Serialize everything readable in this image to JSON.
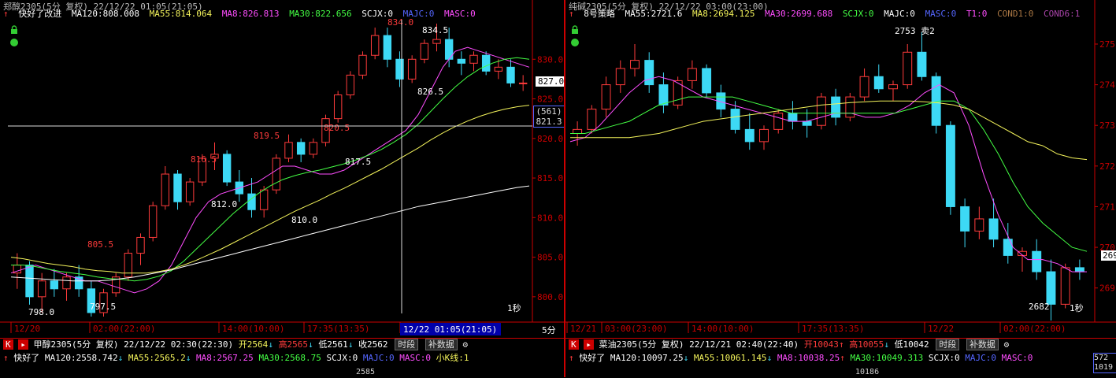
{
  "left": {
    "title": "郑醇2305(5分 复权) 22/12/22 01:05(21:05)",
    "indicator_name": "快好了改进",
    "ma120": "MA120:808.008",
    "ma55": "MA55:814.064",
    "ma8": "MA8:826.813",
    "ma30": "MA30:822.656",
    "scjx": "SCJX:0",
    "majc": "MAJC:0",
    "masc": "MASC:0",
    "price_tag": "827.0",
    "cursor_box_top": "(561)",
    "cursor_box_bottom": "821.3",
    "interval_label": "1秒",
    "period_label": "5分",
    "y_ticks": [
      "830.0",
      "825.0",
      "820.0",
      "815.0",
      "810.0",
      "805.0",
      "800.0"
    ],
    "x_labels": [
      "12/20",
      "02:00(22:00)",
      "14:00(10:00)",
      "17:35(13:35)",
      "12/22 01:05(21:05)"
    ],
    "annotations": [
      "834.0",
      "834.5",
      "826.5",
      "820.5",
      "819.5",
      "817.5",
      "816.5",
      "812.0",
      "810.0",
      "805.5",
      "797.5",
      "798.0"
    ]
  },
  "right": {
    "title": "纯碱2305(5分 复权) 22/12/22 03:00(23:00)",
    "indicator_name": "8号策略",
    "ma55": "MA55:2721.6",
    "ma8": "MA8:2694.125",
    "ma30": "MA30:2699.688",
    "scjx": "SCJX:0",
    "majc": "MAJC:0",
    "masc": "MASC:0",
    "t1": "T1:0",
    "cond1": "COND1:0",
    "cond6": "COND6:1",
    "price_tag": "269",
    "interval_label": "1秒",
    "signal_label": "2753 卖2",
    "low_label": "2682",
    "y_ticks": [
      "275",
      "274",
      "273",
      "272",
      "271",
      "270",
      "269"
    ],
    "x_labels": [
      "12/21",
      "03:00(23:00)",
      "14:00(10:00)",
      "17:35(13:35)",
      "12/22",
      "02:00(22:00)"
    ]
  },
  "bottom_left": {
    "k_label": "K",
    "symbol": "甲醇2305(5分 复权) 22/12/22 02:30(22:30)",
    "open": "开2564",
    "high": "高2565",
    "low": "低2561",
    "close": "收2562",
    "btn_period": "时段",
    "btn_data": "补数据",
    "indicator_name": "快好了",
    "ma120": "MA120:2558.742",
    "ma55": "MA55:2565.2",
    "ma8": "MA8:2567.25",
    "ma30": "MA30:2568.75",
    "scjx": "SCJX:0",
    "majc": "MAJC:0",
    "masc": "MASC:0",
    "small_k": "小K线:1",
    "peek": "2585"
  },
  "bottom_right": {
    "k_label": "K",
    "symbol": "菜油2305(5分 复权) 22/12/21 02:40(22:40)",
    "open": "开10043",
    "high": "高10055",
    "low": "低10042",
    "btn_period": "时段",
    "btn_data": "补数据",
    "indicator_name": "快好了",
    "ma120": "MA120:10097.25",
    "ma55": "MA55:10061.145",
    "ma8": "MA8:10038.25",
    "ma30": "MA30:10049.313",
    "scjx": "SCJX:0",
    "majc": "MAJC:0",
    "masc": "MASC:0",
    "side_top": "572",
    "side_bottom": "1019",
    "peek": "10186"
  },
  "colors": {
    "up": "#ff3b3b",
    "down": "#3dd9f5",
    "ma8": "#ff4dff",
    "ma30": "#44ff44",
    "ma55": "#f3f35b",
    "ma120": "#ffffff",
    "axis": "#cc0000"
  },
  "chart_data": [
    {
      "type": "candlestick",
      "ylim": [
        797,
        835
      ],
      "series": [
        {
          "name": "MA8",
          "values": [
            803,
            803.5,
            804,
            803.5,
            803,
            802.5,
            802,
            802,
            801.5,
            801,
            800.5,
            801,
            802,
            804,
            807,
            810,
            812,
            813,
            813.5,
            814,
            814.5,
            815.5,
            816.5,
            816.5,
            816,
            815.5,
            815.5,
            816,
            817,
            818,
            819,
            820,
            821,
            823,
            826,
            829,
            831,
            831.5,
            831,
            830.5,
            830,
            829.5,
            829
          ]
        },
        {
          "name": "MA30",
          "values": [
            804,
            804,
            803.8,
            803.5,
            803.2,
            803,
            802.8,
            802.5,
            802.3,
            802.2,
            802,
            802.2,
            802.6,
            803.3,
            804.5,
            806,
            807.5,
            809,
            810.5,
            811.8,
            813,
            814,
            814.8,
            815.3,
            815.7,
            816,
            816.4,
            816.8,
            817.3,
            817.9,
            818.6,
            819.5,
            820.5,
            821.8,
            823.4,
            825,
            826.5,
            827.8,
            828.8,
            829.5,
            830,
            830.2,
            830
          ]
        },
        {
          "name": "MA55",
          "values": [
            805,
            804.8,
            804.5,
            804.2,
            804,
            803.8,
            803.5,
            803.3,
            803.2,
            803,
            803,
            803,
            803.2,
            803.5,
            804,
            804.6,
            805.3,
            806,
            806.8,
            807.6,
            808.4,
            809.2,
            810,
            810.8,
            811.5,
            812.2,
            813,
            813.7,
            814.5,
            815.3,
            816.1,
            817,
            817.9,
            818.8,
            819.8,
            820.7,
            821.5,
            822.2,
            822.8,
            823.3,
            823.7,
            824,
            824.2
          ]
        },
        {
          "name": "MA120",
          "values": [
            802.5,
            802.4,
            802.3,
            802.2,
            802.1,
            802,
            802,
            802,
            802.1,
            802.3,
            802.5,
            802.8,
            803.1,
            803.4,
            803.8,
            804.2,
            804.6,
            805,
            805.4,
            805.8,
            806.2,
            806.6,
            807,
            807.4,
            807.8,
            808.2,
            808.6,
            809,
            809.4,
            809.8,
            810.2,
            810.6,
            811,
            811.4,
            811.7,
            812,
            812.3,
            812.6,
            812.9,
            813.2,
            813.5,
            813.8,
            814
          ]
        }
      ],
      "candles": [
        [
          803,
          805.5,
          801,
          804
        ],
        [
          804,
          804.5,
          799,
          800
        ],
        [
          800,
          803,
          798,
          802
        ],
        [
          802,
          803.5,
          800,
          801
        ],
        [
          801,
          803,
          799.5,
          802.5
        ],
        [
          802.5,
          804,
          800,
          801
        ],
        [
          801,
          802,
          797.5,
          798
        ],
        [
          798,
          801,
          797.5,
          800.5
        ],
        [
          800.5,
          803,
          800,
          802.5
        ],
        [
          802.5,
          806,
          802,
          805.5
        ],
        [
          805.5,
          808,
          804,
          807.5
        ],
        [
          807.5,
          812,
          807,
          811.5
        ],
        [
          811.5,
          816.5,
          811,
          815.5
        ],
        [
          815.5,
          816,
          811,
          812
        ],
        [
          812,
          815,
          811.5,
          814.5
        ],
        [
          814.5,
          818,
          814,
          817.5
        ],
        [
          817.5,
          819.5,
          816,
          818
        ],
        [
          818,
          818.5,
          814,
          814.5
        ],
        [
          814.5,
          816,
          812,
          813
        ],
        [
          813,
          815,
          810,
          811
        ],
        [
          811,
          814,
          810,
          813.5
        ],
        [
          813.5,
          818,
          813,
          817.5
        ],
        [
          817.5,
          820.5,
          817,
          819.5
        ],
        [
          819.5,
          820,
          817,
          818
        ],
        [
          818,
          820,
          817.5,
          819.5
        ],
        [
          819.5,
          823,
          819,
          822.5
        ],
        [
          822.5,
          826,
          822,
          825.5
        ],
        [
          825.5,
          828.5,
          825,
          828
        ],
        [
          828,
          831,
          827.5,
          830.5
        ],
        [
          830.5,
          834,
          830,
          833
        ],
        [
          833,
          834,
          829,
          830
        ],
        [
          830,
          831,
          826.5,
          827.5
        ],
        [
          827.5,
          830.5,
          827,
          830
        ],
        [
          830,
          832.5,
          829.5,
          832
        ],
        [
          832,
          834.5,
          831,
          832.5
        ],
        [
          832.5,
          834,
          829,
          830
        ],
        [
          830,
          831,
          828,
          829.5
        ],
        [
          829.5,
          831,
          828.5,
          830.5
        ],
        [
          830.5,
          831,
          828,
          828.5
        ],
        [
          828.5,
          830,
          827.5,
          829
        ],
        [
          829,
          830,
          826.5,
          827
        ],
        [
          827,
          828,
          826,
          827
        ]
      ]
    },
    {
      "type": "candlestick",
      "ylim": [
        2682,
        2756
      ],
      "series": [
        {
          "name": "MA8",
          "values": [
            2726,
            2727,
            2730,
            2734,
            2738,
            2741,
            2742,
            2741,
            2739,
            2737,
            2736,
            2735,
            2734,
            2733,
            2732,
            2731,
            2731,
            2732,
            2733,
            2733,
            2732,
            2732,
            2733,
            2735,
            2738,
            2740,
            2738,
            2730,
            2718,
            2708,
            2700,
            2697,
            2697,
            2696,
            2694,
            2694
          ]
        },
        {
          "name": "MA30",
          "values": [
            2728,
            2728,
            2729,
            2730,
            2731,
            2733,
            2735,
            2736,
            2737,
            2737,
            2737,
            2737,
            2736,
            2735,
            2734,
            2733,
            2733,
            2733,
            2733,
            2733,
            2733,
            2733,
            2733,
            2734,
            2735,
            2736,
            2736,
            2734,
            2729,
            2723,
            2716,
            2710,
            2706,
            2703,
            2700,
            2699
          ]
        },
        {
          "name": "MA55",
          "values": [
            2727,
            2727,
            2727,
            2727,
            2727,
            2727.5,
            2728,
            2729,
            2730,
            2731,
            2731.5,
            2732,
            2732.5,
            2733,
            2733.5,
            2734,
            2734.5,
            2735,
            2735.3,
            2735.6,
            2735.8,
            2736,
            2736,
            2736,
            2735.8,
            2735.5,
            2735,
            2734,
            2732,
            2730,
            2728,
            2726,
            2725,
            2723,
            2722,
            2721.6
          ]
        }
      ],
      "candles": [
        [
          2728,
          2731,
          2725,
          2729
        ],
        [
          2729,
          2735,
          2728,
          2734
        ],
        [
          2734,
          2742,
          2732,
          2740
        ],
        [
          2740,
          2746,
          2738,
          2744
        ],
        [
          2744,
          2750,
          2742,
          2746
        ],
        [
          2746,
          2748,
          2738,
          2740
        ],
        [
          2740,
          2743,
          2733,
          2735
        ],
        [
          2735,
          2742,
          2734,
          2741
        ],
        [
          2741,
          2746,
          2739,
          2744
        ],
        [
          2744,
          2745,
          2737,
          2738
        ],
        [
          2738,
          2740,
          2732,
          2734
        ],
        [
          2734,
          2736,
          2728,
          2729
        ],
        [
          2729,
          2733,
          2724,
          2726
        ],
        [
          2726,
          2730,
          2724,
          2729
        ],
        [
          2729,
          2734,
          2728,
          2733
        ],
        [
          2733,
          2736,
          2729,
          2731
        ],
        [
          2731,
          2734,
          2727,
          2730
        ],
        [
          2730,
          2738,
          2729,
          2737
        ],
        [
          2737,
          2739,
          2730,
          2732
        ],
        [
          2732,
          2738,
          2731,
          2737
        ],
        [
          2737,
          2744,
          2736,
          2742
        ],
        [
          2742,
          2745,
          2738,
          2739
        ],
        [
          2739,
          2741,
          2736,
          2740
        ],
        [
          2740,
          2750,
          2739,
          2748
        ],
        [
          2748,
          2753,
          2741,
          2742
        ],
        [
          2742,
          2743,
          2728,
          2730
        ],
        [
          2730,
          2731,
          2708,
          2710
        ],
        [
          2710,
          2712,
          2700,
          2704
        ],
        [
          2704,
          2710,
          2702,
          2707
        ],
        [
          2707,
          2712,
          2700,
          2702
        ],
        [
          2702,
          2706,
          2696,
          2698
        ],
        [
          2698,
          2700,
          2694,
          2699
        ],
        [
          2699,
          2702,
          2692,
          2694
        ],
        [
          2694,
          2697,
          2682,
          2686
        ],
        [
          2686,
          2696,
          2685,
          2695
        ],
        [
          2695,
          2697,
          2692,
          2694
        ]
      ]
    }
  ]
}
